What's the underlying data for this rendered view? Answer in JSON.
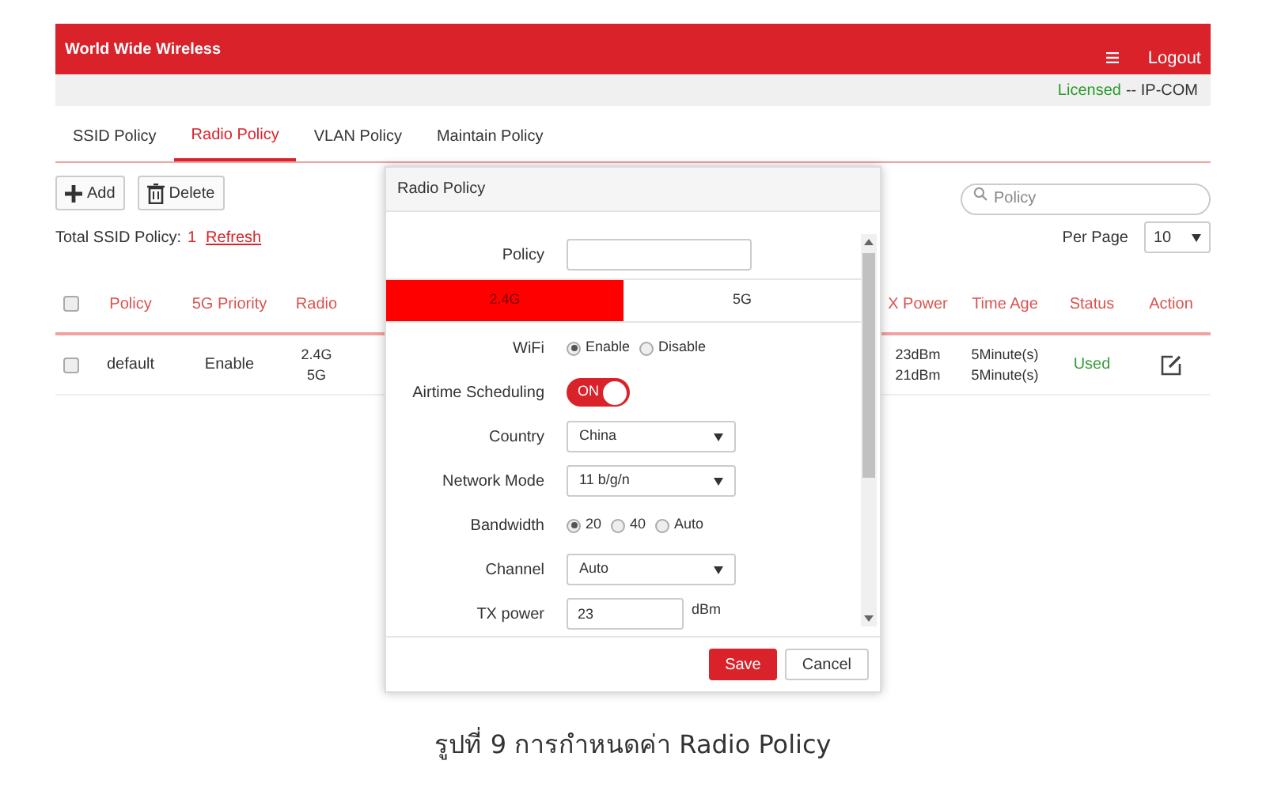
{
  "header": {
    "brand": "World Wide Wireless",
    "logout": "Logout"
  },
  "license": {
    "status": "Licensed",
    "vendor": "-- IP-COM"
  },
  "tabs": [
    {
      "label": "SSID Policy",
      "selected": false
    },
    {
      "label": "Radio Policy",
      "selected": true
    },
    {
      "label": "VLAN Policy",
      "selected": false
    },
    {
      "label": "Maintain Policy",
      "selected": false
    }
  ],
  "toolbar": {
    "buttons": [
      {
        "label": "Add",
        "kind": "add"
      },
      {
        "label": "Delete",
        "kind": "delete"
      }
    ],
    "search": {
      "placeholder": "Policy"
    }
  },
  "summary": {
    "label": "Total SSID Policy:",
    "count": "1",
    "refresh": "Refresh",
    "per_page_label": "Per Page",
    "per_page": "10"
  },
  "table": {
    "header_checked": false,
    "columns": [
      "Policy",
      "5G Priority",
      "Radio",
      "X Power",
      "Time Age",
      "Status",
      "Action"
    ],
    "rows": [
      {
        "checked": false,
        "policy": "default",
        "priority": "Enable",
        "radio": [
          "2.4G",
          "5G"
        ],
        "tx_power": [
          "23dBm",
          "21dBm"
        ],
        "time_age": [
          "5Minute(s)",
          "5Minute(s)"
        ],
        "status": "Used"
      }
    ]
  },
  "modal": {
    "title": "Radio Policy",
    "policy_label": "Policy",
    "bands": [
      {
        "label": "2.4G",
        "selected": true
      },
      {
        "label": "5G",
        "selected": false
      }
    ],
    "fields": [
      {
        "kind": "radio",
        "label": "WiFi",
        "options": [
          {
            "label": "Enable",
            "selected": true
          },
          {
            "label": "Disable",
            "selected": false
          }
        ]
      },
      {
        "kind": "toggle",
        "label": "Airtime Scheduling",
        "on": true,
        "text": "ON"
      },
      {
        "kind": "select",
        "label": "Country",
        "value": "China"
      },
      {
        "kind": "select",
        "label": "Network Mode",
        "value": "11 b/g/n"
      },
      {
        "kind": "radio",
        "label": "Bandwidth",
        "options": [
          {
            "label": "20",
            "selected": true
          },
          {
            "label": "40",
            "selected": false
          },
          {
            "label": "Auto",
            "selected": false
          }
        ]
      },
      {
        "kind": "select",
        "label": "Channel",
        "value": "Auto"
      },
      {
        "kind": "input",
        "label": "TX power",
        "value": "23",
        "unit": "dBm"
      }
    ],
    "buttons": [
      {
        "label": "Save",
        "kind": "primary"
      },
      {
        "label": "Cancel",
        "kind": "secondary"
      }
    ]
  },
  "caption": "รูปที่ 9 การกำหนดค่า Radio Policy"
}
